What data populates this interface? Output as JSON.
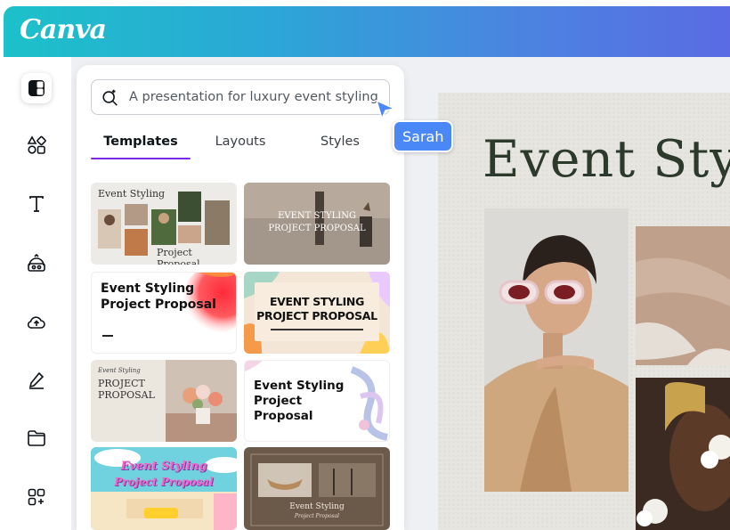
{
  "app": {
    "logo": "Canva"
  },
  "search": {
    "placeholder": "A presentation for luxury event styling"
  },
  "tabs": [
    {
      "label": "Templates",
      "active": true
    },
    {
      "label": "Layouts",
      "active": false
    },
    {
      "label": "Styles",
      "active": false
    }
  ],
  "sidebar": {
    "items": [
      {
        "icon": "design-icon",
        "active": true
      },
      {
        "icon": "elements-icon"
      },
      {
        "icon": "text-icon"
      },
      {
        "icon": "brand-icon"
      },
      {
        "icon": "uploads-icon"
      },
      {
        "icon": "draw-icon"
      },
      {
        "icon": "projects-icon"
      },
      {
        "icon": "apps-icon"
      }
    ]
  },
  "templates": [
    {
      "title": "Event Styling",
      "subtitle": "Project Proposal"
    },
    {
      "title": "EVENT STYLING",
      "subtitle": "PROJECT PROPOSAL"
    },
    {
      "title": "Event Styling",
      "subtitle": "Project Proposal"
    },
    {
      "title": "EVENT STYLING",
      "subtitle": "PROJECT PROPOSAL"
    },
    {
      "title": "Event Styling",
      "subtitle": "PROJECT",
      "subtitle2": "PROPOSAL"
    },
    {
      "title": "Event Styling",
      "subtitle": "Project",
      "subtitle2": "Proposal"
    },
    {
      "title": "Event Styling",
      "subtitle": "Project Proposal"
    },
    {
      "title": "Event Styling",
      "subtitle": "Project Proposal"
    }
  ],
  "canvas": {
    "title": "Event Styling"
  },
  "collaborator": {
    "name": "Sarah"
  },
  "colors": {
    "accent": "#7d2ae8",
    "cursor": "#4a88f7"
  }
}
